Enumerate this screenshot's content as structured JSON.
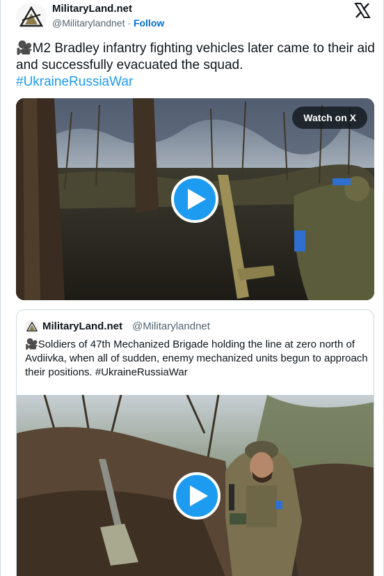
{
  "author": {
    "name": "MilitaryLand.net",
    "handle": "@Militarylandnet",
    "separator": " · ",
    "follow_label": "Follow"
  },
  "tweet": {
    "emoji": "🎥",
    "text": "M2 Bradley infantry fighting vehicles later came to their aid and successfully evacuated the squad.",
    "hashtag": "#UkraineRussiaWar"
  },
  "media": {
    "watch_label": "Watch on X"
  },
  "quote": {
    "name": "MilitaryLand.net",
    "handle": "@Militarylandnet",
    "emoji": "🎥",
    "text": "Soldiers of 47th Mechanized Brigade holding the line at zero north of Avdiivka, when all of sudden, enemy mechanized units begun to approach their positions. #UkraineRussiaWar"
  },
  "colors": {
    "accent": "#1d9bf0",
    "follow": "#006fd6",
    "text": "#0f1419",
    "muted": "#536471",
    "border": "#cfd9de"
  },
  "icons": [
    "militaryland-logo",
    "x-logo-icon",
    "play-icon",
    "video-camera-emoji"
  ]
}
